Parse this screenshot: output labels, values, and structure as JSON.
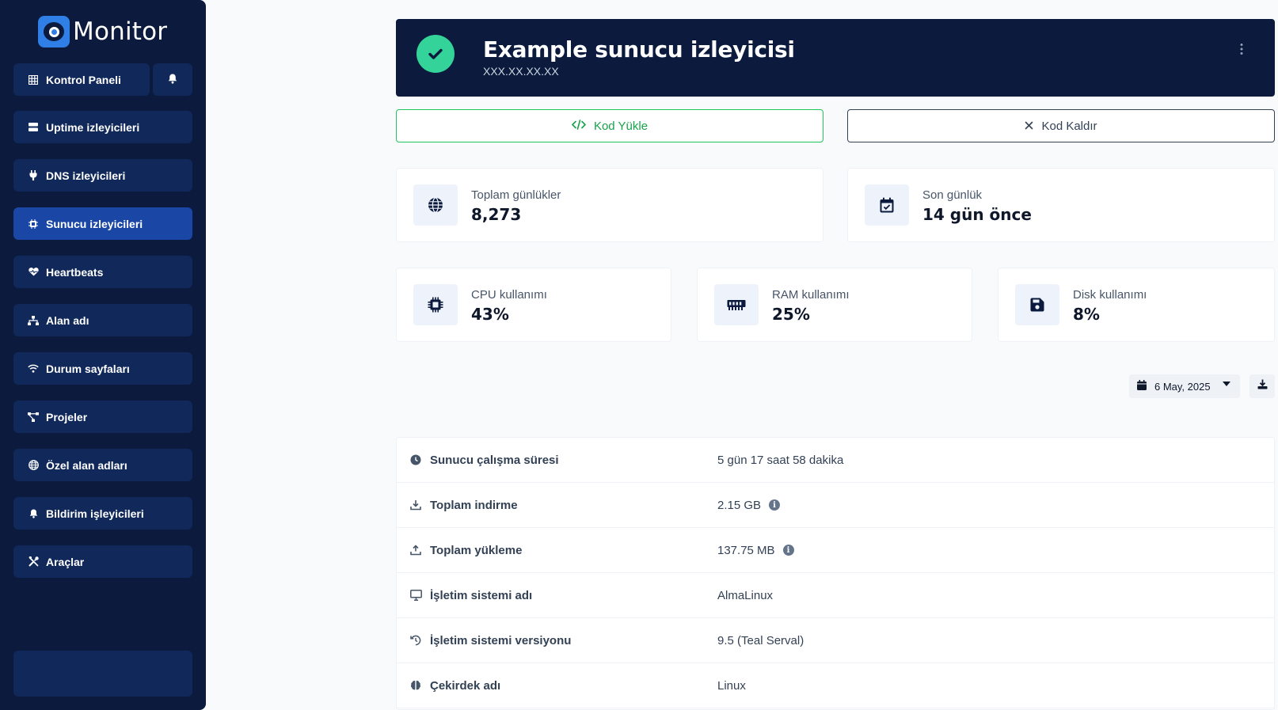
{
  "app": {
    "name": "Monitor"
  },
  "sidebar": {
    "items": [
      {
        "label": "Kontrol Paneli",
        "icon": "table-grid-icon"
      },
      {
        "label": "Uptime izleyicileri",
        "icon": "server-icon"
      },
      {
        "label": "DNS izleyicileri",
        "icon": "plug-icon"
      },
      {
        "label": "Sunucu izleyicileri",
        "icon": "microchip-icon",
        "active": true
      },
      {
        "label": "Heartbeats",
        "icon": "heart-pulse-icon"
      },
      {
        "label": "Alan adı",
        "icon": "network-icon"
      },
      {
        "label": "Durum sayfaları",
        "icon": "wifi-icon"
      },
      {
        "label": "Projeler",
        "icon": "project-diagram-icon"
      },
      {
        "label": "Özel alan adları",
        "icon": "globe-icon"
      },
      {
        "label": "Bildirim işleyicileri",
        "icon": "bell-icon"
      },
      {
        "label": "Araçlar",
        "icon": "tools-icon"
      }
    ]
  },
  "header": {
    "title": "Example sunucu izleyicisi",
    "subtitle": "XXX.XX.XX.XX",
    "status": "ok"
  },
  "actions": {
    "install_label": "Kod Yükle",
    "remove_label": "Kod Kaldır"
  },
  "stats": {
    "total_logs": {
      "label": "Toplam günlükler",
      "value": "8,273"
    },
    "last_log": {
      "label": "Son günlük",
      "value": "14 gün önce"
    },
    "cpu": {
      "label": "CPU kullanımı",
      "value": "43%"
    },
    "ram": {
      "label": "RAM kullanımı",
      "value": "25%"
    },
    "disk": {
      "label": "Disk kullanımı",
      "value": "8%"
    }
  },
  "date_filter": {
    "value": "6 May, 2025"
  },
  "info_rows": [
    {
      "label": "Sunucu çalışma süresi",
      "value": "5 gün 17 saat 58 dakika",
      "icon": "clock-icon"
    },
    {
      "label": "Toplam indirme",
      "value": "2.15 GB",
      "icon": "download-icon",
      "info": true
    },
    {
      "label": "Toplam yükleme",
      "value": "137.75 MB",
      "icon": "upload-icon",
      "info": true
    },
    {
      "label": "İşletim sistemi adı",
      "value": "AlmaLinux",
      "icon": "desktop-icon"
    },
    {
      "label": "İşletim sistemi versiyonu",
      "value": "9.5 (Teal Serval)",
      "icon": "history-icon"
    },
    {
      "label": "Çekirdek adı",
      "value": "Linux",
      "icon": "brain-icon"
    }
  ],
  "colors": {
    "sidebar_bg": "#0b1a3d",
    "nav_item_bg": "#10295a",
    "nav_active_bg": "#1a46a6",
    "success": "#34d399",
    "install_border": "#22c55e"
  }
}
